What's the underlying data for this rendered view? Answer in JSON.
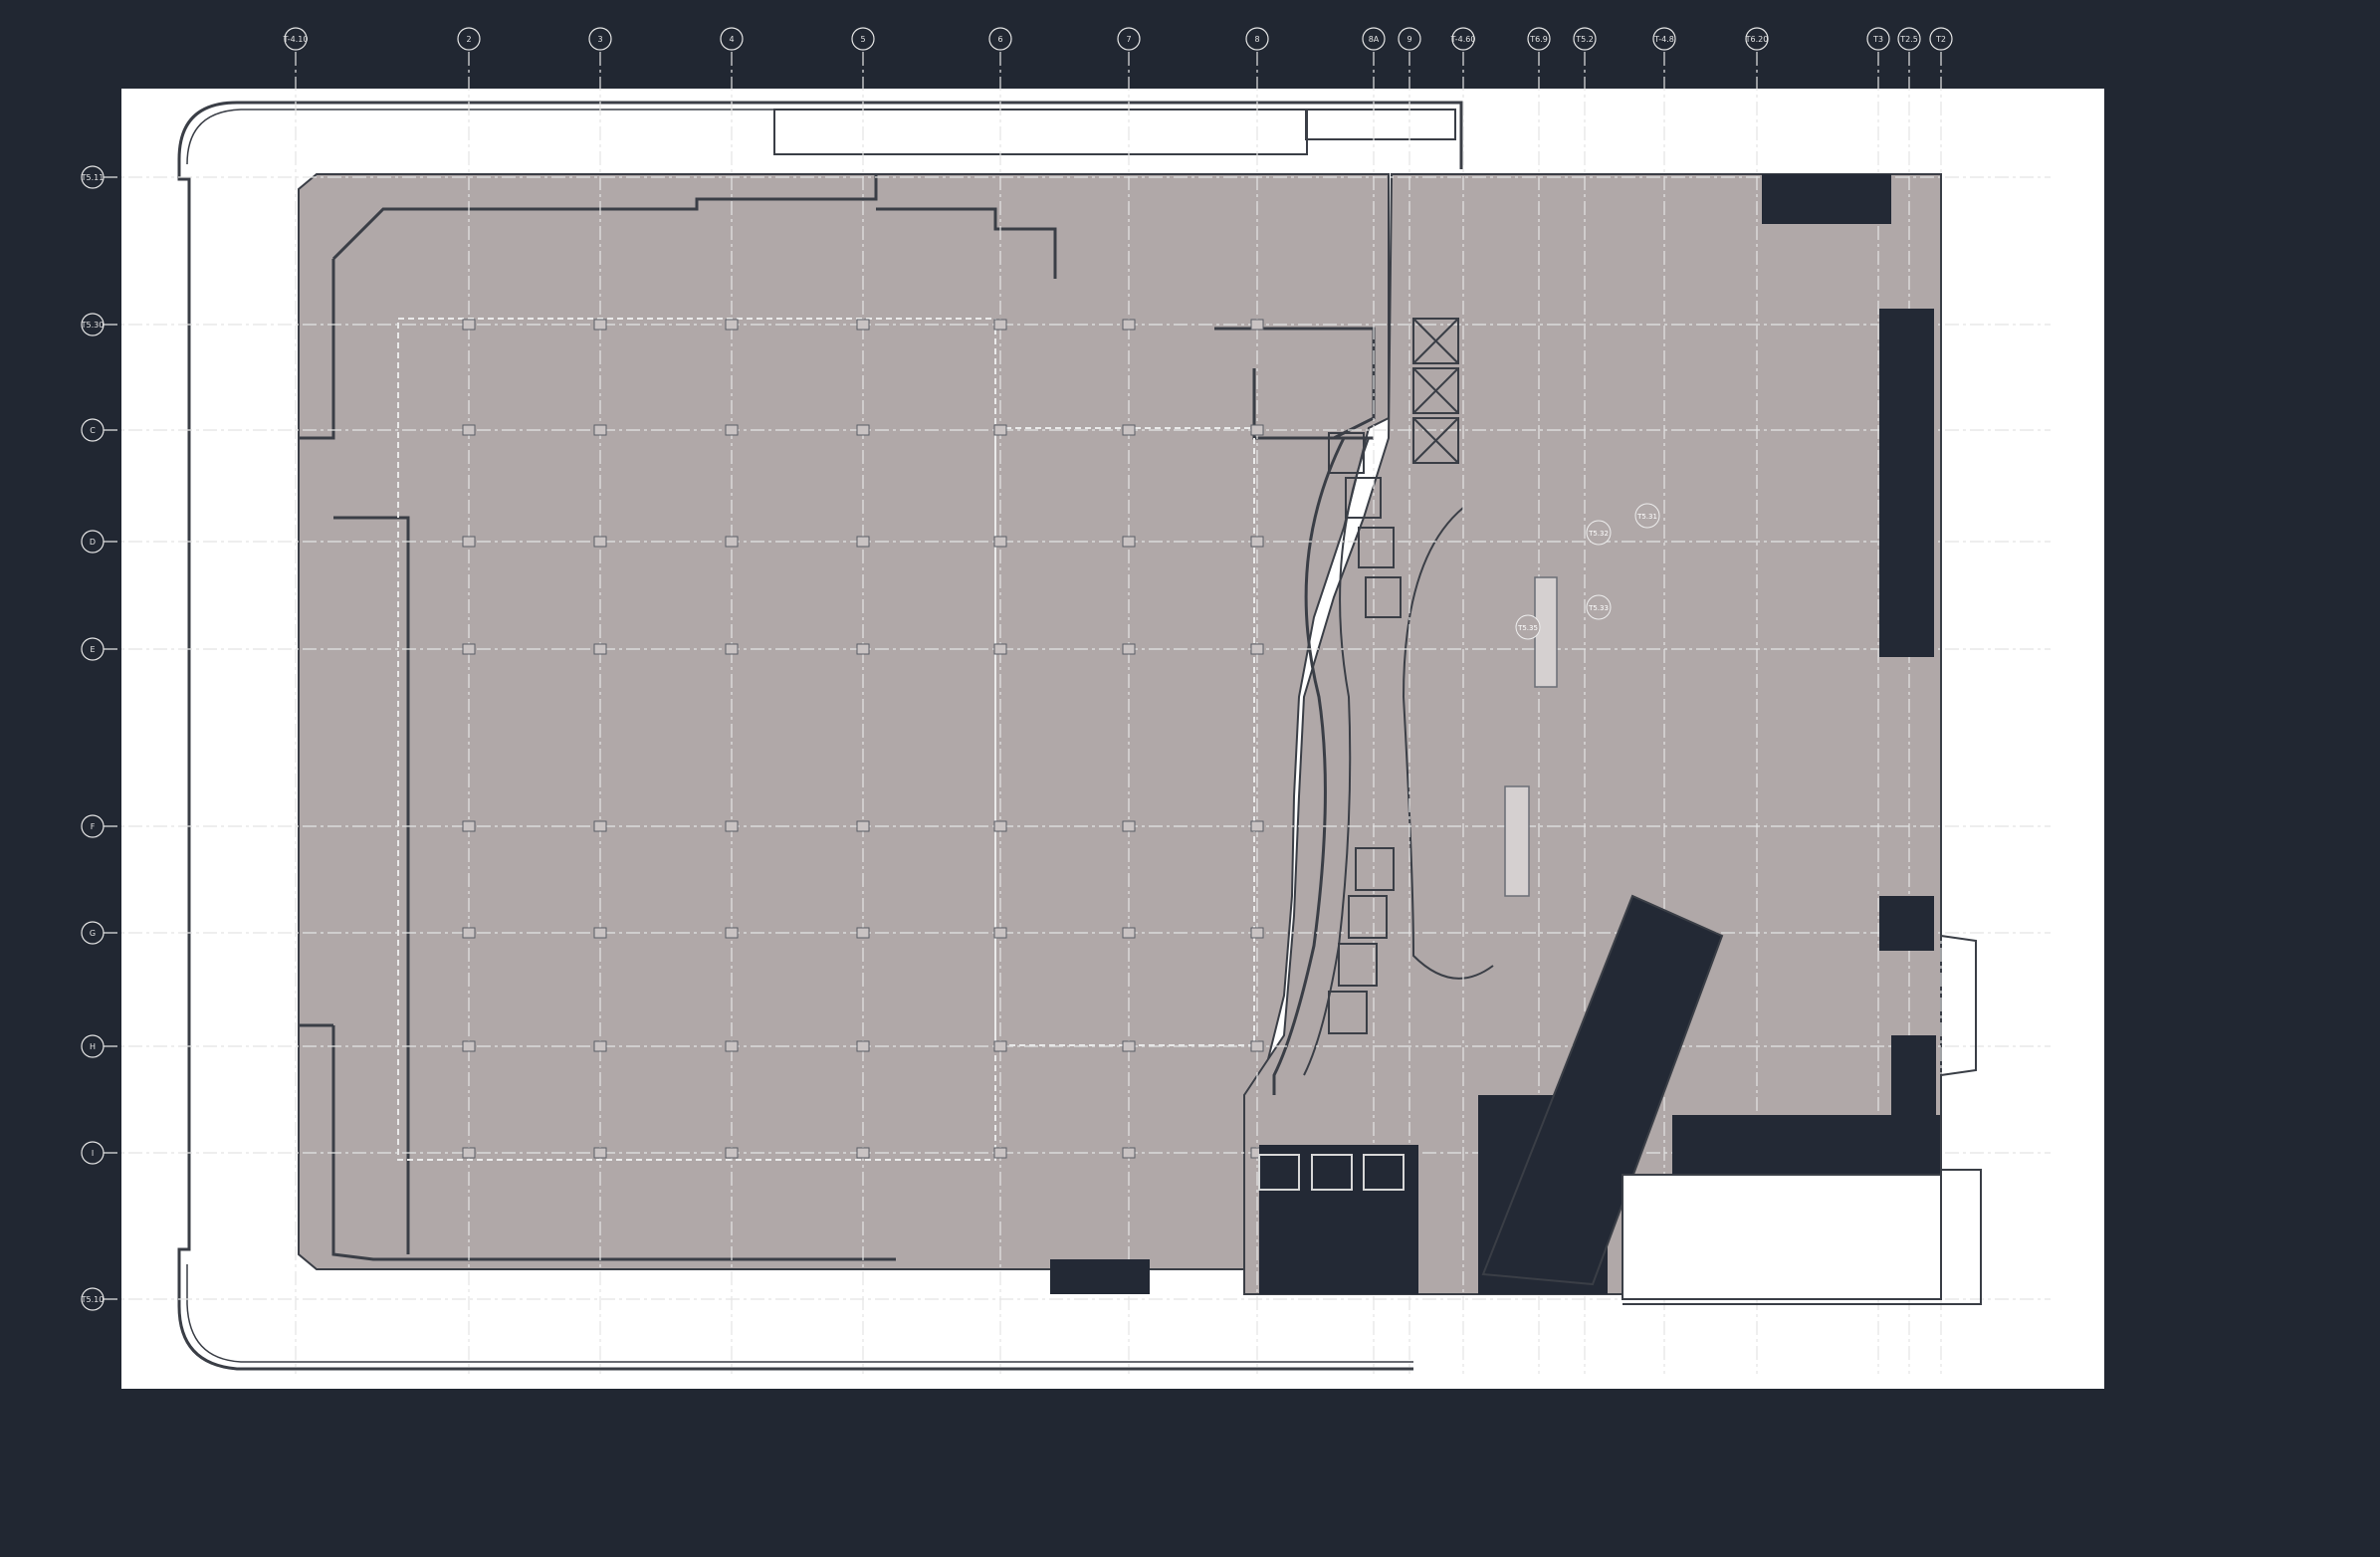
{
  "colors": {
    "background": "#212732",
    "sheet": "#ffffff",
    "floor_fill": "#b0a8a8",
    "wall": "#3a3e46",
    "dark_fill": "#232935",
    "grid_line": "#d7d7d7"
  },
  "grid": {
    "top_labels": [
      "T-4.10",
      "2",
      "3",
      "4",
      "5",
      "6",
      "7",
      "8",
      "8A",
      "9",
      "T-4.60",
      "T6.9",
      "T5.2",
      "T-4.8",
      "T6.20",
      "T3",
      "T2.5",
      "T2"
    ],
    "left_labels": [
      "T5.11",
      "T5.30",
      "C",
      "D",
      "E",
      "F",
      "G",
      "H",
      "I",
      "T5.10"
    ]
  },
  "room_tags": [
    "T5.31",
    "T5.32",
    "T5.33",
    "T5.35"
  ]
}
